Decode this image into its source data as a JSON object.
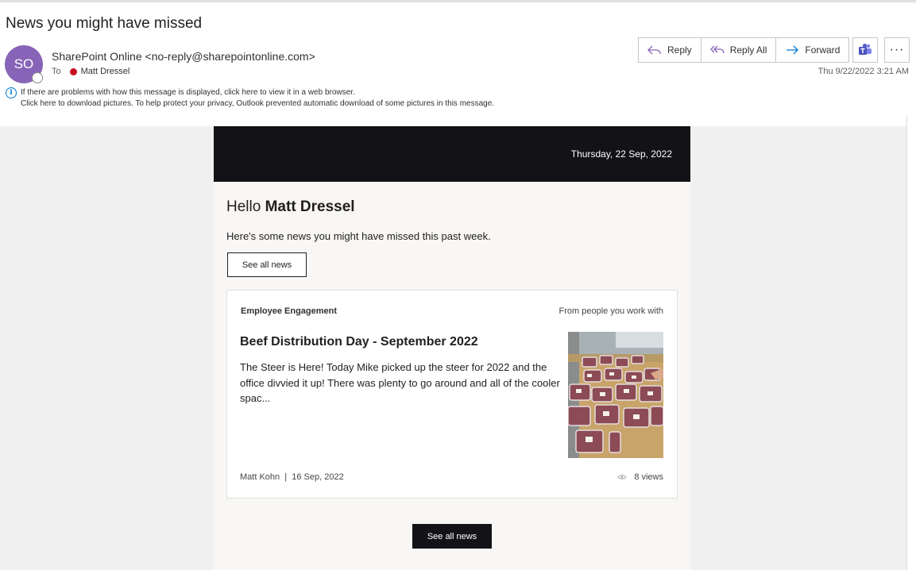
{
  "message": {
    "subject": "News you might have missed",
    "sender_initials": "SO",
    "sender": "SharePoint Online <no-reply@sharepointonline.com>",
    "to_label": "To",
    "recipient": "Matt Dressel",
    "date": "Thu 9/22/2022 3:21 AM",
    "notice_line1": "If there are problems with how this message is displayed, click here to view it in a web browser.",
    "notice_line2": "Click here to download pictures. To help protect your privacy, Outlook prevented automatic download of some pictures in this message."
  },
  "toolbar": {
    "reply_label": "Reply",
    "reply_all_label": "Reply All",
    "forward_label": "Forward",
    "more_label": "···"
  },
  "email": {
    "header_date": "Thursday, 22 Sep, 2022",
    "greeting": "Hello",
    "greeting_name": "Matt Dressel",
    "intro": "Here's some news you might have missed this past week.",
    "see_all_label": "See all news",
    "card": {
      "category": "Employee Engagement",
      "source": "From people you work with",
      "title": "Beef Distribution Day - September 2022",
      "excerpt": "The Steer is Here!  Today Mike picked up the steer for 2022 and the office divvied it up! There was plenty to go around and all of the cooler spac...",
      "author": "Matt Kohn",
      "separator": "|",
      "date": "16 Sep, 2022",
      "views": "8 views"
    },
    "see_all_bottom_label": "See all news"
  },
  "colors": {
    "avatar": "#8764b8",
    "header_dark": "#131317",
    "presence_red": "#c50f1f",
    "accent": "#0078d4"
  }
}
